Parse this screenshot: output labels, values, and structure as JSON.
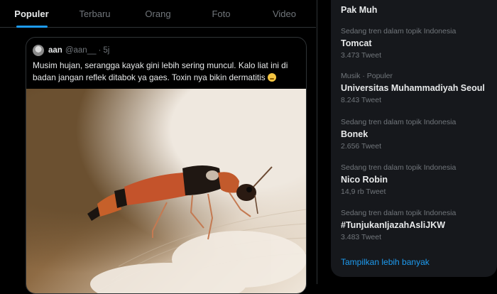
{
  "tabs": [
    "Populer",
    "Terbaru",
    "Orang",
    "Foto",
    "Video"
  ],
  "tweet": {
    "name": "aan",
    "handle": "@aan__",
    "separator": "·",
    "time": "5j",
    "text": "Musim hujan, serangga kayak gini lebih sering muncul. Kalo liat ini di badan jangan reflek ditabok ya gaes. Toxin nya bikin dermatitis"
  },
  "trends": {
    "top_name": "Pak Muh",
    "items": [
      {
        "meta": "Sedang tren dalam topik Indonesia",
        "name": "Tomcat",
        "count": "3.473 Tweet"
      },
      {
        "meta": "Musik · Populer",
        "name": "Universitas Muhammadiyah Seoul",
        "count": "8.243 Tweet"
      },
      {
        "meta": "Sedang tren dalam topik Indonesia",
        "name": "Bonek",
        "count": "2.656 Tweet"
      },
      {
        "meta": "Sedang tren dalam topik Indonesia",
        "name": "Nico Robin",
        "count": "14,9 rb Tweet"
      },
      {
        "meta": "Sedang tren dalam topik Indonesia",
        "name": "#TunjukanIjazahAsliJKW",
        "count": "3.483 Tweet"
      }
    ],
    "show_more": "Tampilkan lebih banyak"
  },
  "colors": {
    "accent": "#1d9bf0",
    "background": "#000000",
    "panel": "#16181c"
  }
}
